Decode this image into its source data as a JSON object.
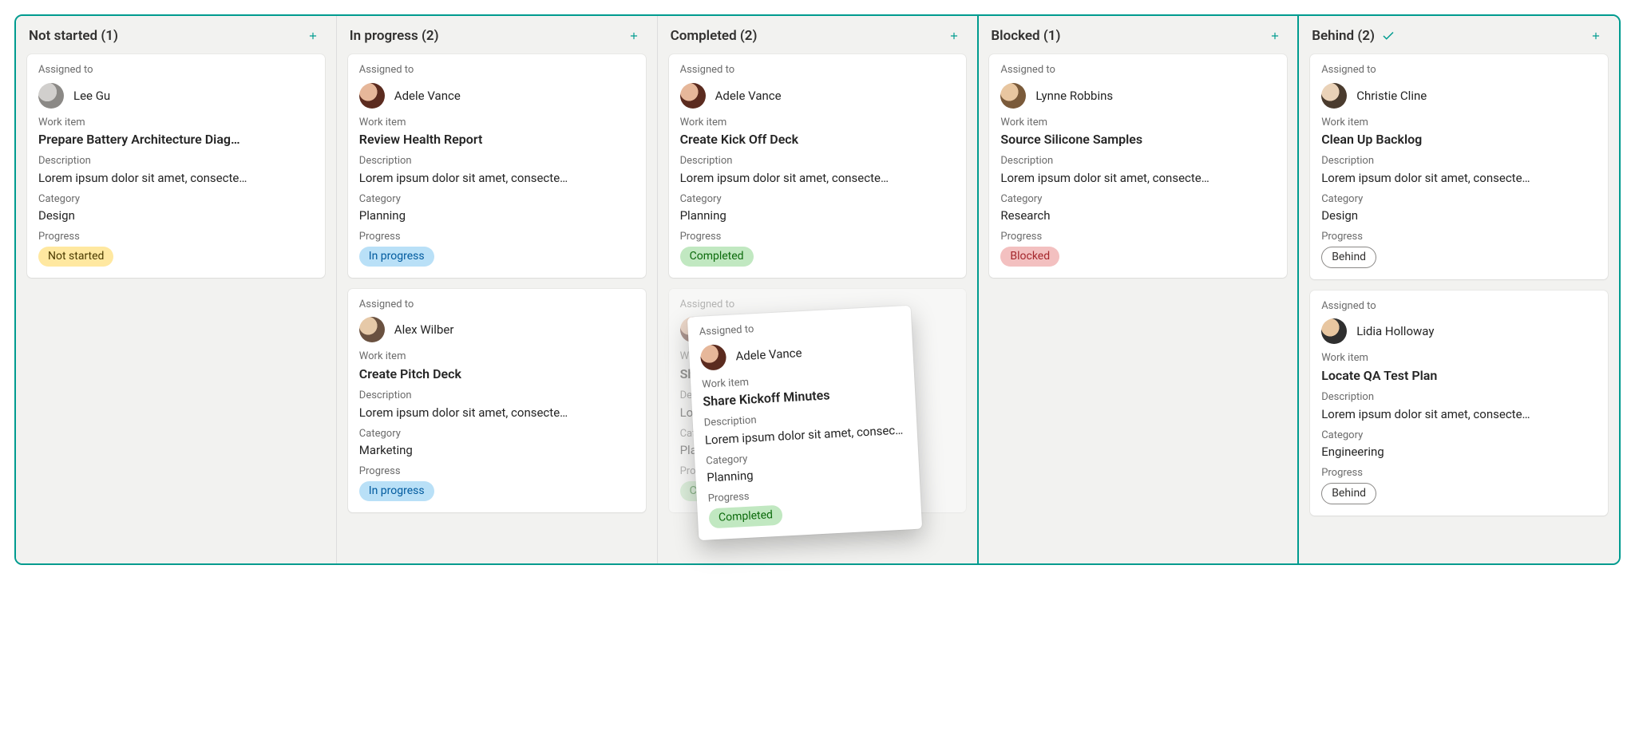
{
  "labels": {
    "assigned_to": "Assigned to",
    "work_item": "Work item",
    "description": "Description",
    "category": "Category",
    "progress": "Progress"
  },
  "columns": [
    {
      "title": "Not started (1)",
      "divider": "none",
      "check": false
    },
    {
      "title": "In progress (2)",
      "divider": "none",
      "check": false
    },
    {
      "title": "Completed (2)",
      "divider": "none",
      "check": false
    },
    {
      "title": "Blocked (1)",
      "divider": "both",
      "check": false
    },
    {
      "title": "Behind (2)",
      "divider": "none",
      "check": true
    }
  ],
  "cards": {
    "c0": [
      {
        "assignee": "Lee Gu",
        "avatarClass": "av-lee",
        "title": "Prepare Battery Architecture Diag…",
        "desc": "Lorem ipsum dolor sit amet, consecte…",
        "category": "Design",
        "progress": "Not started",
        "pill": "pill-yellow"
      }
    ],
    "c1": [
      {
        "assignee": "Adele Vance",
        "avatarClass": "av-adele",
        "title": "Review Health Report",
        "desc": "Lorem ipsum dolor sit amet, consecte…",
        "category": "Planning",
        "progress": "In progress",
        "pill": "pill-blue"
      },
      {
        "assignee": "Alex Wilber",
        "avatarClass": "av-alex",
        "title": "Create Pitch Deck",
        "desc": "Lorem ipsum dolor sit amet, consecte…",
        "category": "Marketing",
        "progress": "In progress",
        "pill": "pill-blue"
      }
    ],
    "c2": [
      {
        "assignee": "Adele Vance",
        "avatarClass": "av-adele",
        "title": "Create Kick Off Deck",
        "desc": "Lorem ipsum dolor sit amet, consecte…",
        "category": "Planning",
        "progress": "Completed",
        "pill": "pill-green"
      },
      {
        "assignee": "Adele Vance",
        "avatarClass": "av-adele",
        "title": "Share Kickoff Minutes",
        "desc": "Lorem ipsum dolor sit amet, consecte…",
        "category": "Planning",
        "progress": "Completed",
        "pill": "pill-green",
        "faded": true
      }
    ],
    "c3": [
      {
        "assignee": "Lynne Robbins",
        "avatarClass": "av-lynne",
        "title": "Source Silicone Samples",
        "desc": "Lorem ipsum dolor sit amet, consecte…",
        "category": "Research",
        "progress": "Blocked",
        "pill": "pill-red"
      }
    ],
    "c4": [
      {
        "assignee": "Christie Cline",
        "avatarClass": "av-christie",
        "title": "Clean Up Backlog",
        "desc": "Lorem ipsum dolor sit amet, consecte…",
        "category": "Design",
        "progress": "Behind",
        "pill": "pill-outline"
      },
      {
        "assignee": "Lidia Holloway",
        "avatarClass": "av-lidia",
        "title": "Locate QA Test Plan",
        "desc": "Lorem ipsum dolor sit amet, consecte…",
        "category": "Engineering",
        "progress": "Behind",
        "pill": "pill-outline"
      }
    ]
  },
  "drag": {
    "assignee": "Adele Vance",
    "avatarClass": "av-adele",
    "title": "Share Kickoff Minutes",
    "desc": "Lorem ipsum dolor sit amet, consectet…",
    "category": "Planning",
    "progress": "Completed",
    "pill": "pill-green"
  }
}
